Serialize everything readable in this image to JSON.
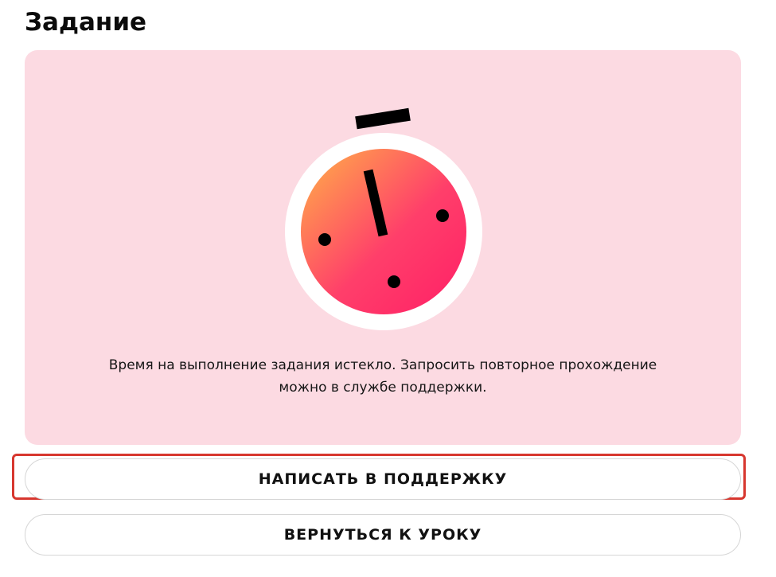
{
  "page": {
    "title": "Задание"
  },
  "task_card": {
    "background": "#fcdae2",
    "illustration_icon": "stopwatch-icon",
    "message": "Время на выполнение задания истекло. Запросить повторное прохождение можно в службе поддержки."
  },
  "actions": {
    "support_label": "НАПИСАТЬ В ПОДДЕРЖКУ",
    "back_label": "ВЕРНУТЬСЯ К УРОКУ"
  },
  "colors": {
    "highlight": "#d7372f",
    "gradient_start": "#ffb347",
    "gradient_end": "#ff1f66"
  }
}
